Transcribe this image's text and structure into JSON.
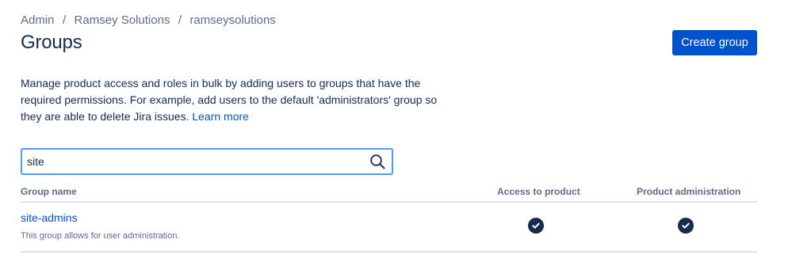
{
  "breadcrumb": {
    "items": [
      "Admin",
      "Ramsey Solutions",
      "ramseysolutions"
    ],
    "separator": "/"
  },
  "header": {
    "title": "Groups",
    "create_button_label": "Create group"
  },
  "description": {
    "text": "Manage product access and roles in bulk by adding users to groups that have the required permissions. For example, add users to the default 'administrators' group so they are able to delete Jira issues.",
    "link_label": "Learn more"
  },
  "search": {
    "value": "site",
    "icon": "search-icon"
  },
  "table": {
    "columns": [
      "Group name",
      "Access to product",
      "Product administration"
    ],
    "rows": [
      {
        "name": "site-admins",
        "description": "This group allows for user administration.",
        "access_to_product": true,
        "product_administration": true
      }
    ]
  },
  "colors": {
    "primary": "#0052cc",
    "focus_border": "#4c9aff",
    "text": "#172b4d",
    "subtle_text": "#5e6c84",
    "check_bg": "#172b4d"
  }
}
